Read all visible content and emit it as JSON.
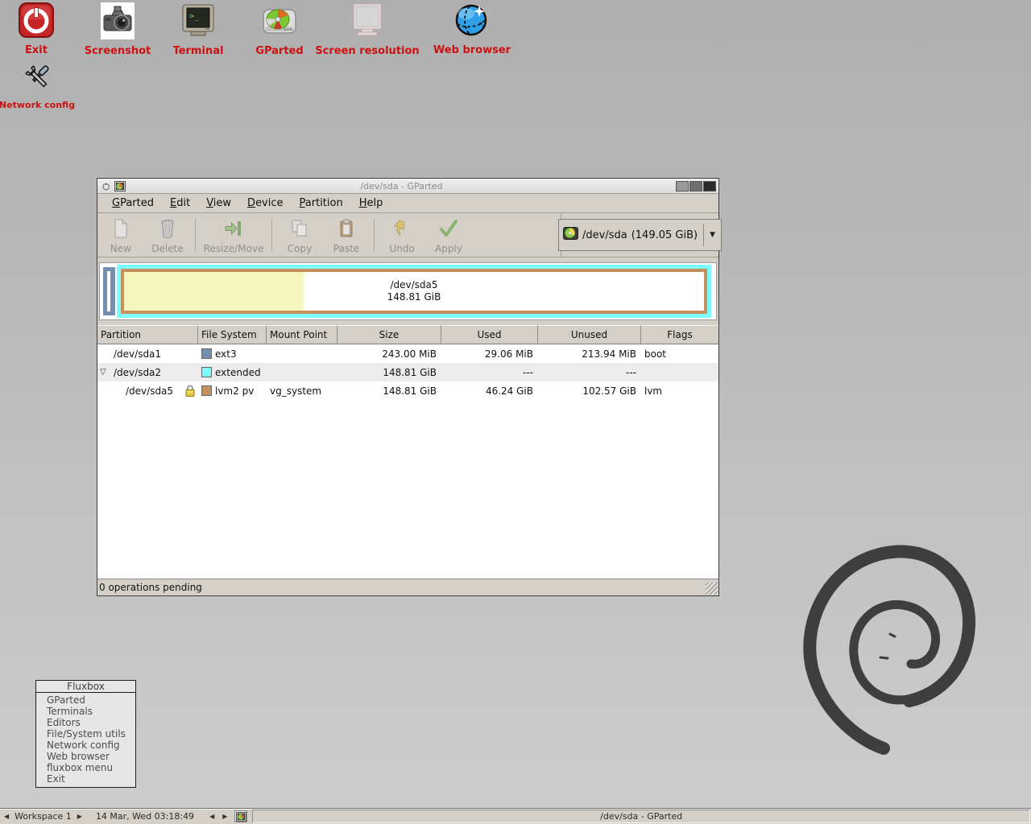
{
  "desktop": {
    "icons": [
      {
        "label": "Exit",
        "icon": "power-icon"
      },
      {
        "label": "Screenshot",
        "icon": "camera-icon"
      },
      {
        "label": "Terminal",
        "icon": "terminal-icon"
      },
      {
        "label": "GParted",
        "icon": "disk-pie-icon"
      },
      {
        "label": "Screen resolution",
        "icon": "monitor-icon"
      },
      {
        "label": "Web browser",
        "icon": "globe-icon"
      },
      {
        "label": "Network config",
        "icon": "crossed-tools-icon"
      }
    ]
  },
  "window": {
    "title": "/dev/sda - GParted",
    "menu": [
      {
        "key": "G",
        "rest": "Parted"
      },
      {
        "key": "E",
        "rest": "dit"
      },
      {
        "key": "V",
        "rest": "iew"
      },
      {
        "key": "D",
        "rest": "evice"
      },
      {
        "key": "P",
        "rest": "artition"
      },
      {
        "key": "H",
        "rest": "elp"
      }
    ],
    "toolbar": {
      "buttons": [
        "New",
        "Delete",
        "Resize/Move",
        "Copy",
        "Paste",
        "Undo",
        "Apply"
      ],
      "device": {
        "name": "/dev/sda",
        "size": "(149.05 GiB)"
      }
    },
    "visual": {
      "sda5_label": "/dev/sda5",
      "sda5_size": "148.81 GiB",
      "used_percent": 31
    },
    "table": {
      "headers": [
        "Partition",
        "File System",
        "Mount Point",
        "Size",
        "Used",
        "Unused",
        "Flags"
      ],
      "rows": [
        {
          "partition": "/dev/sda1",
          "fs": "ext3",
          "mount": "",
          "size": "243.00 MiB",
          "used": "29.06 MiB",
          "unused": "213.94 MiB",
          "flags": "boot"
        },
        {
          "partition": "/dev/sda2",
          "fs": "extended",
          "mount": "",
          "size": "148.81 GiB",
          "used": "---",
          "unused": "---",
          "flags": ""
        },
        {
          "partition": "/dev/sda5",
          "fs": "lvm2 pv",
          "mount": "vg_system",
          "size": "148.81 GiB",
          "used": "46.24 GiB",
          "unused": "102.57 GiB",
          "flags": "lvm"
        }
      ]
    },
    "status": "0 operations pending"
  },
  "fluxbox_menu": {
    "title": "Fluxbox",
    "items": [
      "GParted",
      "Terminals",
      "Editors",
      "File/System utils",
      "Network config",
      "Web browser",
      "fluxbox menu",
      "Exit"
    ]
  },
  "taskbar": {
    "workspace": "Workspace 1",
    "clock": "14 Mar, Wed 03:18:49",
    "task": "/dev/sda - GParted"
  },
  "colors": {
    "fs_ext3": "#7590AE",
    "fs_extended": "#7DFCFE",
    "fs_lvm2_pv": "#C6905C",
    "used_fill": "#F5F5BE",
    "desktop_label": "#CC1111",
    "gtk_bg": "#D4D0C8",
    "debian_swirl": "#3E3E3E"
  }
}
